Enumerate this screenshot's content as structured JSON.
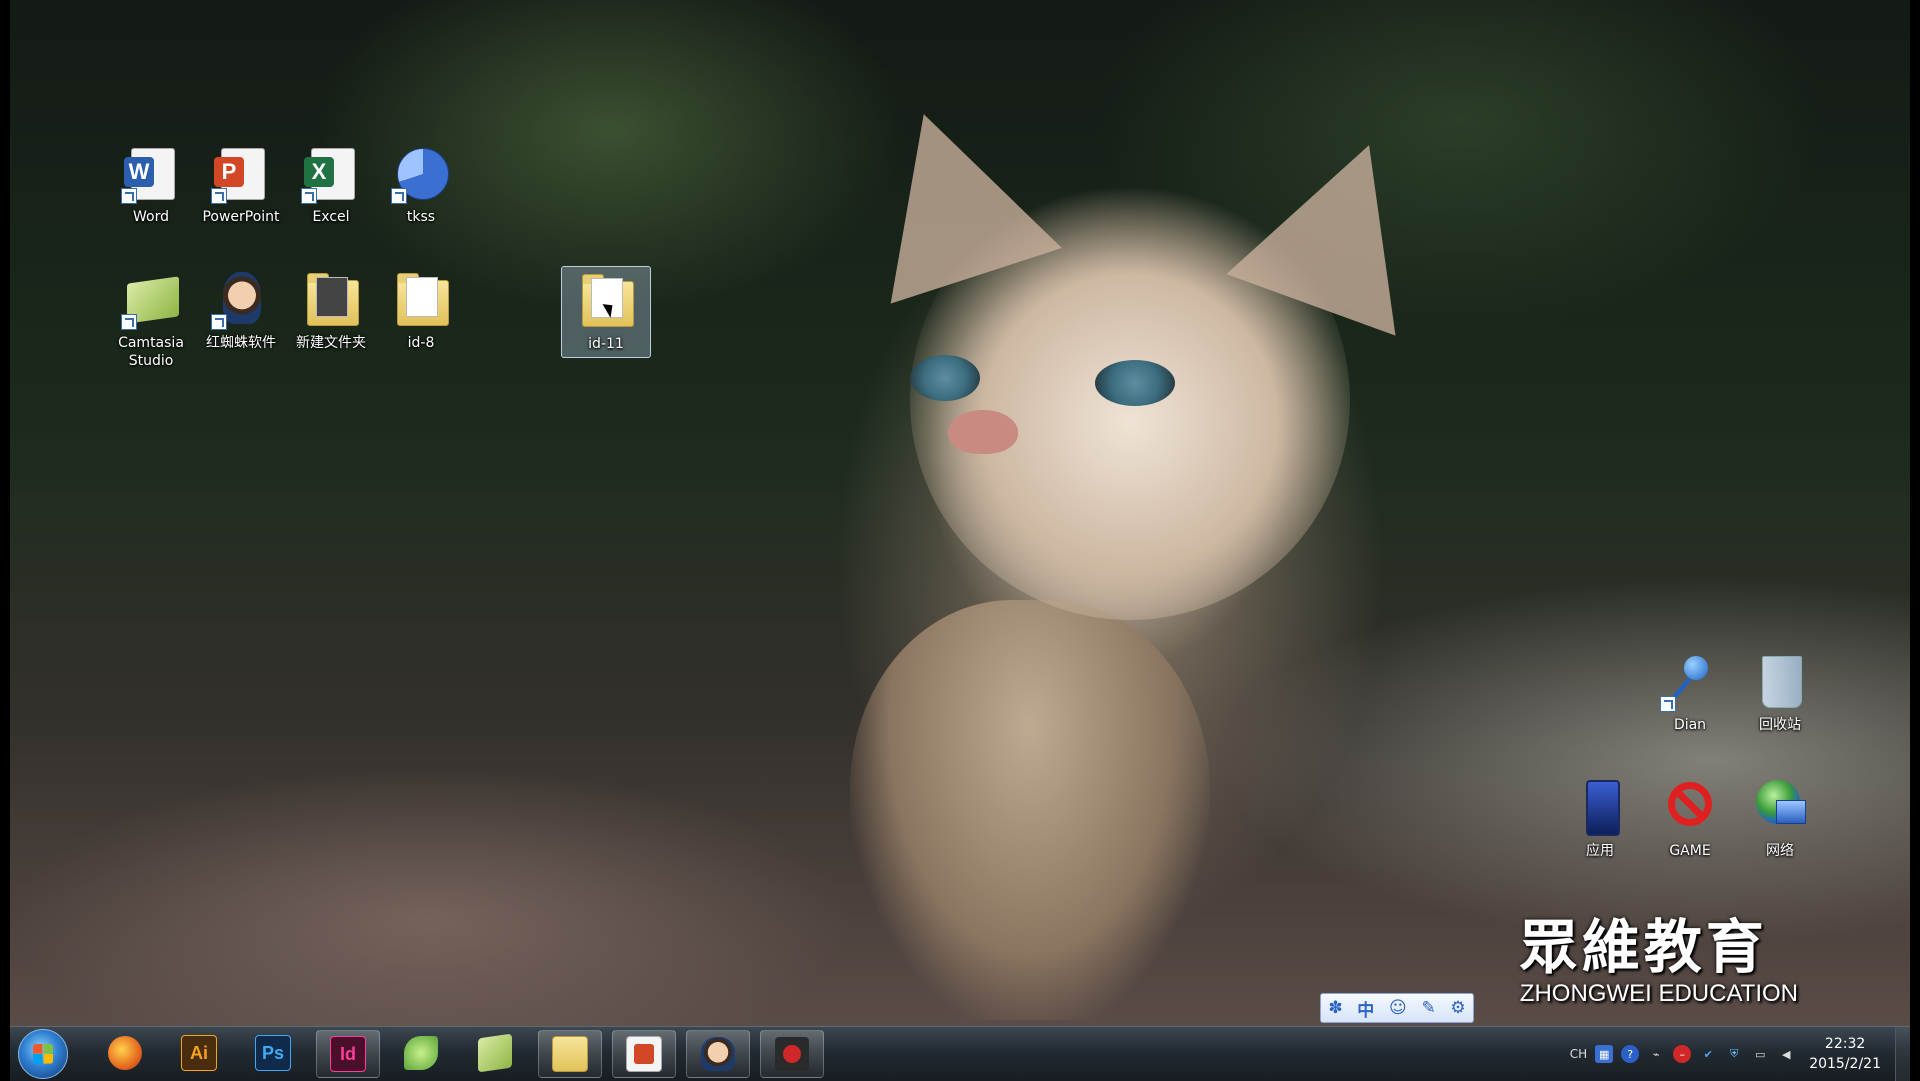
{
  "desktop": {
    "icons": [
      {
        "label": "Word",
        "kind": "word",
        "glyph": "W",
        "color": "#2b5fad"
      },
      {
        "label": "PowerPoint",
        "kind": "powerpoint",
        "glyph": "P",
        "color": "#d24726"
      },
      {
        "label": "Excel",
        "kind": "excel",
        "glyph": "X",
        "color": "#207245"
      },
      {
        "label": "tkss",
        "kind": "tkss"
      },
      {
        "label": "Camtasia Studio",
        "kind": "camtasia"
      },
      {
        "label": "红蜘蛛软件",
        "kind": "red-spider"
      },
      {
        "label": "新建文件夹",
        "kind": "folder"
      },
      {
        "label": "id-8",
        "kind": "folder"
      },
      {
        "label": "id-11",
        "kind": "folder",
        "selected": true
      },
      {
        "label": "Dian",
        "kind": "pin"
      },
      {
        "label": "回收站",
        "kind": "recycle-bin"
      },
      {
        "label": "应用",
        "kind": "app"
      },
      {
        "label": "GAME",
        "kind": "game"
      },
      {
        "label": "网络",
        "kind": "network"
      }
    ]
  },
  "watermark": {
    "chinese": "眾維教育",
    "english": "ZHONGWEI EDUCATION"
  },
  "ime_toolbar": {
    "items": [
      "paw-icon",
      "中",
      "smiley-icon",
      "pencil-icon",
      "gear-icon"
    ],
    "mode_label": "中"
  },
  "taskbar": {
    "pinned": [
      {
        "name": "firefox-icon",
        "glyph": "",
        "color": "#e66a1f"
      },
      {
        "name": "illustrator-icon",
        "glyph": "Ai",
        "color": "#4a2c0e",
        "fg": "#f7a21b"
      },
      {
        "name": "photoshop-icon",
        "glyph": "Ps",
        "color": "#0f2a4a",
        "fg": "#3fa9f5"
      },
      {
        "name": "indesign-icon",
        "glyph": "Id",
        "color": "#4a0f2a",
        "fg": "#ff3d9a",
        "active": true
      },
      {
        "name": "green-leaf-app-icon",
        "glyph": "",
        "color": "#5aa33a"
      },
      {
        "name": "camtasia-icon",
        "glyph": "",
        "color": "#9cbf54"
      },
      {
        "name": "file-explorer-icon",
        "glyph": "",
        "color": "#e9c95c",
        "active": true
      },
      {
        "name": "powerpoint-task-icon",
        "glyph": "",
        "color": "#d24726",
        "active": true
      },
      {
        "name": "red-spider-task-icon",
        "glyph": "",
        "color": "#d8c0a0",
        "active": true
      },
      {
        "name": "recorder-icon",
        "glyph": "",
        "color": "#b4282a",
        "active": true
      }
    ],
    "tray": {
      "language": "CH",
      "time": "22:32",
      "date": "2015/2/21"
    }
  }
}
